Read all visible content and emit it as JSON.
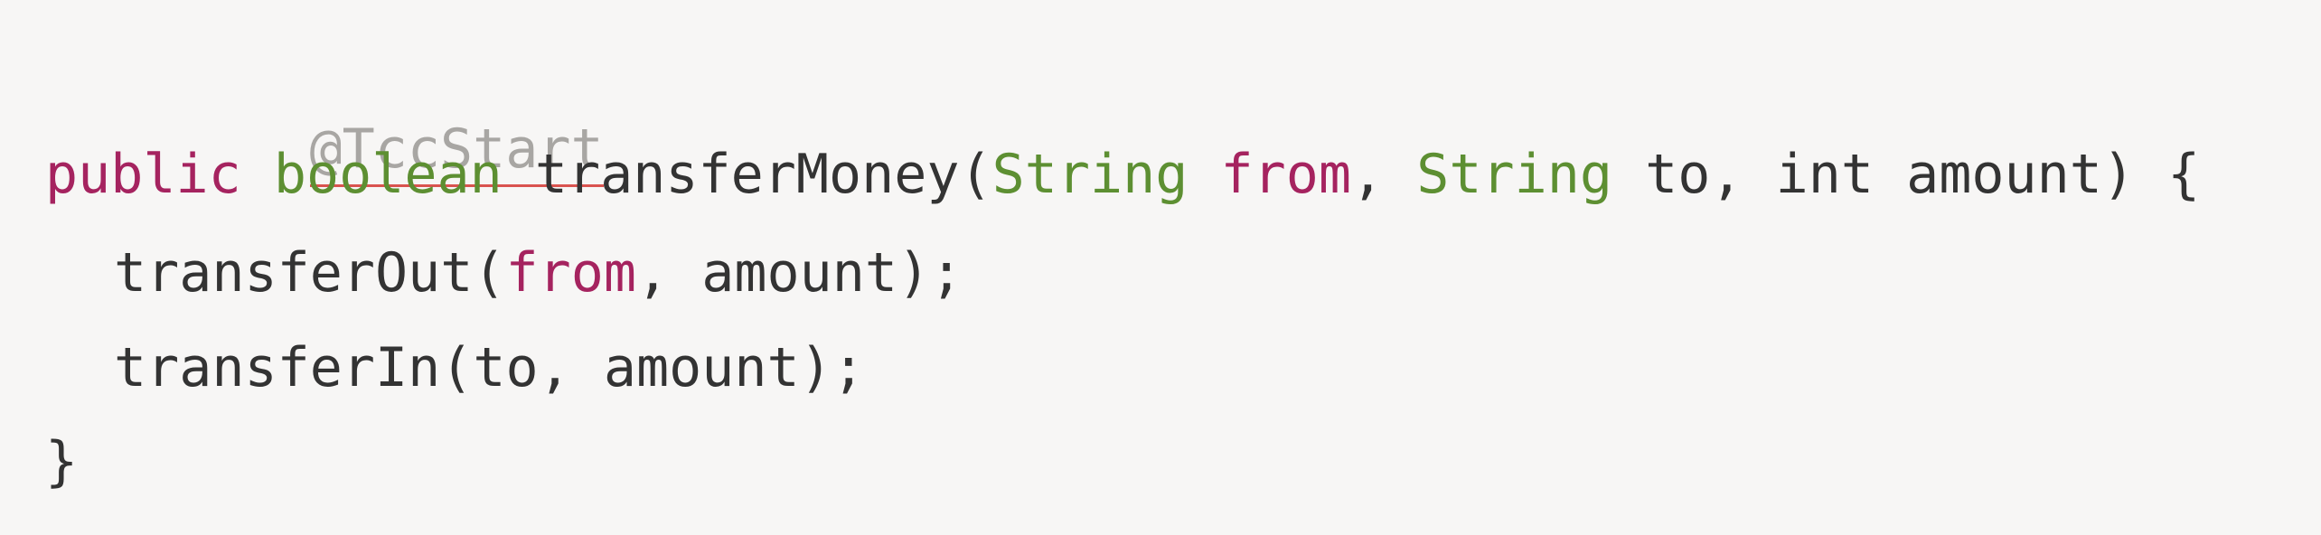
{
  "code": {
    "annotation": "@TccStart",
    "signature": {
      "modifier": "public",
      "return_type": "boolean",
      "method_name": "transferMoney",
      "open_paren": "(",
      "param1_type": "String",
      "param1_name": "from",
      "comma1": ", ",
      "param2_type": "String",
      "param2_name": " to, ",
      "param3_type_and_name": "int amount",
      "close": ") {"
    },
    "body_1": {
      "call": "transferOut(",
      "arg1": "from",
      "rest": ", amount);"
    },
    "body_2": {
      "text": "transferIn(to, amount);"
    },
    "closing_brace": "}"
  },
  "colors": {
    "background": "#f7f6f5",
    "keyword": "#a5235f",
    "type": "#5d8f32",
    "annotation": "#a8a6a3",
    "underline": "#d9534f",
    "text": "#333333"
  }
}
